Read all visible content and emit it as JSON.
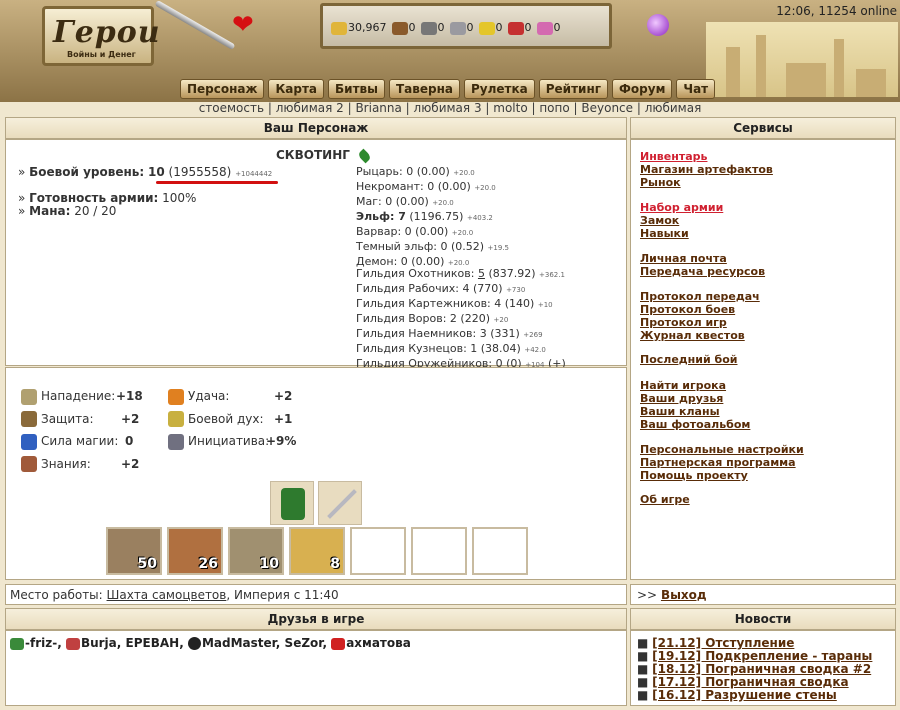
{
  "header": {
    "logo_title": "Герои",
    "logo_subtitle": "Войны и Денег",
    "time_online": "12:06, 11254 online",
    "resources": [
      {
        "icon": "gold-icon",
        "value": "30,967",
        "color": "#e0b53a"
      },
      {
        "icon": "wood-icon",
        "value": "0",
        "color": "#8a5a2b"
      },
      {
        "icon": "ore-icon",
        "value": "0",
        "color": "#777777"
      },
      {
        "icon": "mercury-icon",
        "value": "0",
        "color": "#9a9aa0"
      },
      {
        "icon": "sulfur-icon",
        "value": "0",
        "color": "#e4c62a"
      },
      {
        "icon": "crystal-icon",
        "value": "0",
        "color": "#c53030"
      },
      {
        "icon": "gem-icon",
        "value": "0",
        "color": "#d46ab0"
      }
    ]
  },
  "nav": [
    "Персонаж",
    "Карта",
    "Битвы",
    "Таверна",
    "Рулетка",
    "Рейтинг",
    "Форум",
    "Чат"
  ],
  "sublinks": "стоемость | любимая 2 | Brianna | любимая 3 | molto | попо | Beyonce | любимая",
  "character": {
    "panel_title": "Ваш Персонаж",
    "name": "СКВОТИНГ",
    "level_label": "Боевой уровень:",
    "level": "10",
    "exp": "(1955558)",
    "exp_delta": "+1044442",
    "readiness_label": "Готовность армии:",
    "readiness": "100%",
    "mana_label": "Мана:",
    "mana": "20 / 20",
    "factions": [
      {
        "text": "Рыцарь: 0 (0.00)",
        "delta": "+20.0",
        "bold": false
      },
      {
        "text": "Некромант: 0 (0.00)",
        "delta": "+20.0",
        "bold": false
      },
      {
        "text": "Маг: 0 (0.00)",
        "delta": "+20.0",
        "bold": false
      },
      {
        "text": "Эльф: 7",
        "extra": " (1196.75)",
        "delta": "+403.2",
        "bold": true
      },
      {
        "text": "Варвар: 0 (0.00)",
        "delta": "+20.0",
        "bold": false
      },
      {
        "text": "Темный эльф: 0 (0.52)",
        "delta": "+19.5",
        "bold": false
      },
      {
        "text": "Демон: 0 (0.00)",
        "delta": "+20.0",
        "bold": false
      }
    ],
    "guilds": [
      {
        "pre": "Гильдия Охотников: ",
        "link": "5",
        "post": " (837.92)",
        "delta": "+362.1"
      },
      {
        "pre": "Гильдия Рабочих: 4 (770)",
        "link": "",
        "post": "",
        "delta": "+730"
      },
      {
        "pre": "Гильдия Картежников: 4 (140)",
        "link": "",
        "post": "",
        "delta": "+10"
      },
      {
        "pre": "Гильдия Воров: 2 (220)",
        "link": "",
        "post": "",
        "delta": "+20"
      },
      {
        "pre": "Гильдия Наемников: 3 (331)",
        "link": "",
        "post": "",
        "delta": "+269"
      },
      {
        "pre": "Гильдия Кузнецов: 1 (38.04)",
        "link": "",
        "post": "",
        "delta": "+42.0"
      },
      {
        "pre": "Гильдия Оружейников: 0 (0)",
        "link": "",
        "post": "",
        "delta": "+104"
      }
    ],
    "guild_add": "(+)"
  },
  "stats": {
    "left": [
      {
        "icon": "sword-icon",
        "label": "Нападение:",
        "value": "+18",
        "color": "#b0a070"
      },
      {
        "icon": "shield-icon",
        "label": "Защита:",
        "value": "+2",
        "color": "#8a6a3a"
      },
      {
        "icon": "wand-icon",
        "label": "Сила магии:",
        "value": "0",
        "color": "#3060c0"
      },
      {
        "icon": "book-icon",
        "label": "Знания:",
        "value": "+2",
        "color": "#a05a3a"
      }
    ],
    "right": [
      {
        "icon": "rainbow-icon",
        "label": "Удача:",
        "value": "+2",
        "color": "#e08020"
      },
      {
        "icon": "wings-icon",
        "label": "Боевой дух:",
        "value": "+1",
        "color": "#c8b040"
      },
      {
        "icon": "hourglass-icon",
        "label": "Инициатива:",
        "value": "+9%",
        "color": "#707080"
      }
    ],
    "army": [
      "50",
      "26",
      "10",
      "8",
      "",
      "",
      ""
    ]
  },
  "work": {
    "label": "Место работы:",
    "link": "Шахта самоцветов",
    "tail": ", Империя с 11:40"
  },
  "services": {
    "title": "Сервисы",
    "groups": [
      [
        {
          "label": "Инвентарь",
          "color": "#d02030"
        },
        {
          "label": "Магазин артефактов"
        },
        {
          "label": "Рынок"
        }
      ],
      [
        {
          "label": "Набор армии",
          "color": "#d02030"
        },
        {
          "label": "Замок"
        },
        {
          "label": "Навыки"
        }
      ],
      [
        {
          "label": "Личная почта"
        },
        {
          "label": "Передача ресурсов"
        }
      ],
      [
        {
          "label": "Протокол передач"
        },
        {
          "label": "Протокол боев"
        },
        {
          "label": "Протокол игр"
        },
        {
          "label": "Журнал квестов"
        }
      ],
      [
        {
          "label": "Последний бой"
        }
      ],
      [
        {
          "label": "Найти игрока"
        },
        {
          "label": "Ваши друзья"
        },
        {
          "label": "Ваши кланы"
        },
        {
          "label": "Ваш фотоальбом"
        }
      ],
      [
        {
          "label": "Персональные настройки"
        },
        {
          "label": "Партнерская программа"
        },
        {
          "label": "Помощь проекту"
        }
      ],
      [
        {
          "label": "Об игре"
        }
      ]
    ],
    "exit_prefix": ">>",
    "exit": "Выход"
  },
  "friends": {
    "title": "Друзья в игре",
    "list": [
      {
        "name": "-friz-",
        "sep": ",",
        "icon": "clan-icon",
        "color": "#3a8a3a"
      },
      {
        "name": "Burja",
        "sep": ",",
        "icon": "clan-icon",
        "color": "#c04040"
      },
      {
        "name": "ЕРЕВАН",
        "sep": ",",
        "icon": "",
        "color": ""
      },
      {
        "name": "MadMaster",
        "sep": ",",
        "icon": "clan-icon",
        "color": "#222222"
      },
      {
        "name": "SeZor",
        "sep": ",",
        "icon": "",
        "color": ""
      },
      {
        "name": "ахматова",
        "sep": "",
        "icon": "clan-icon",
        "color": "#d02020"
      }
    ]
  },
  "news": {
    "title": "Новости",
    "items": [
      "[21.12] Отступление",
      "[19.12] Подкрепление - тараны",
      "[18.12] Пограничная сводка #2",
      "[17.12] Пограничная сводка",
      "[16.12] Разрушение стены"
    ]
  }
}
